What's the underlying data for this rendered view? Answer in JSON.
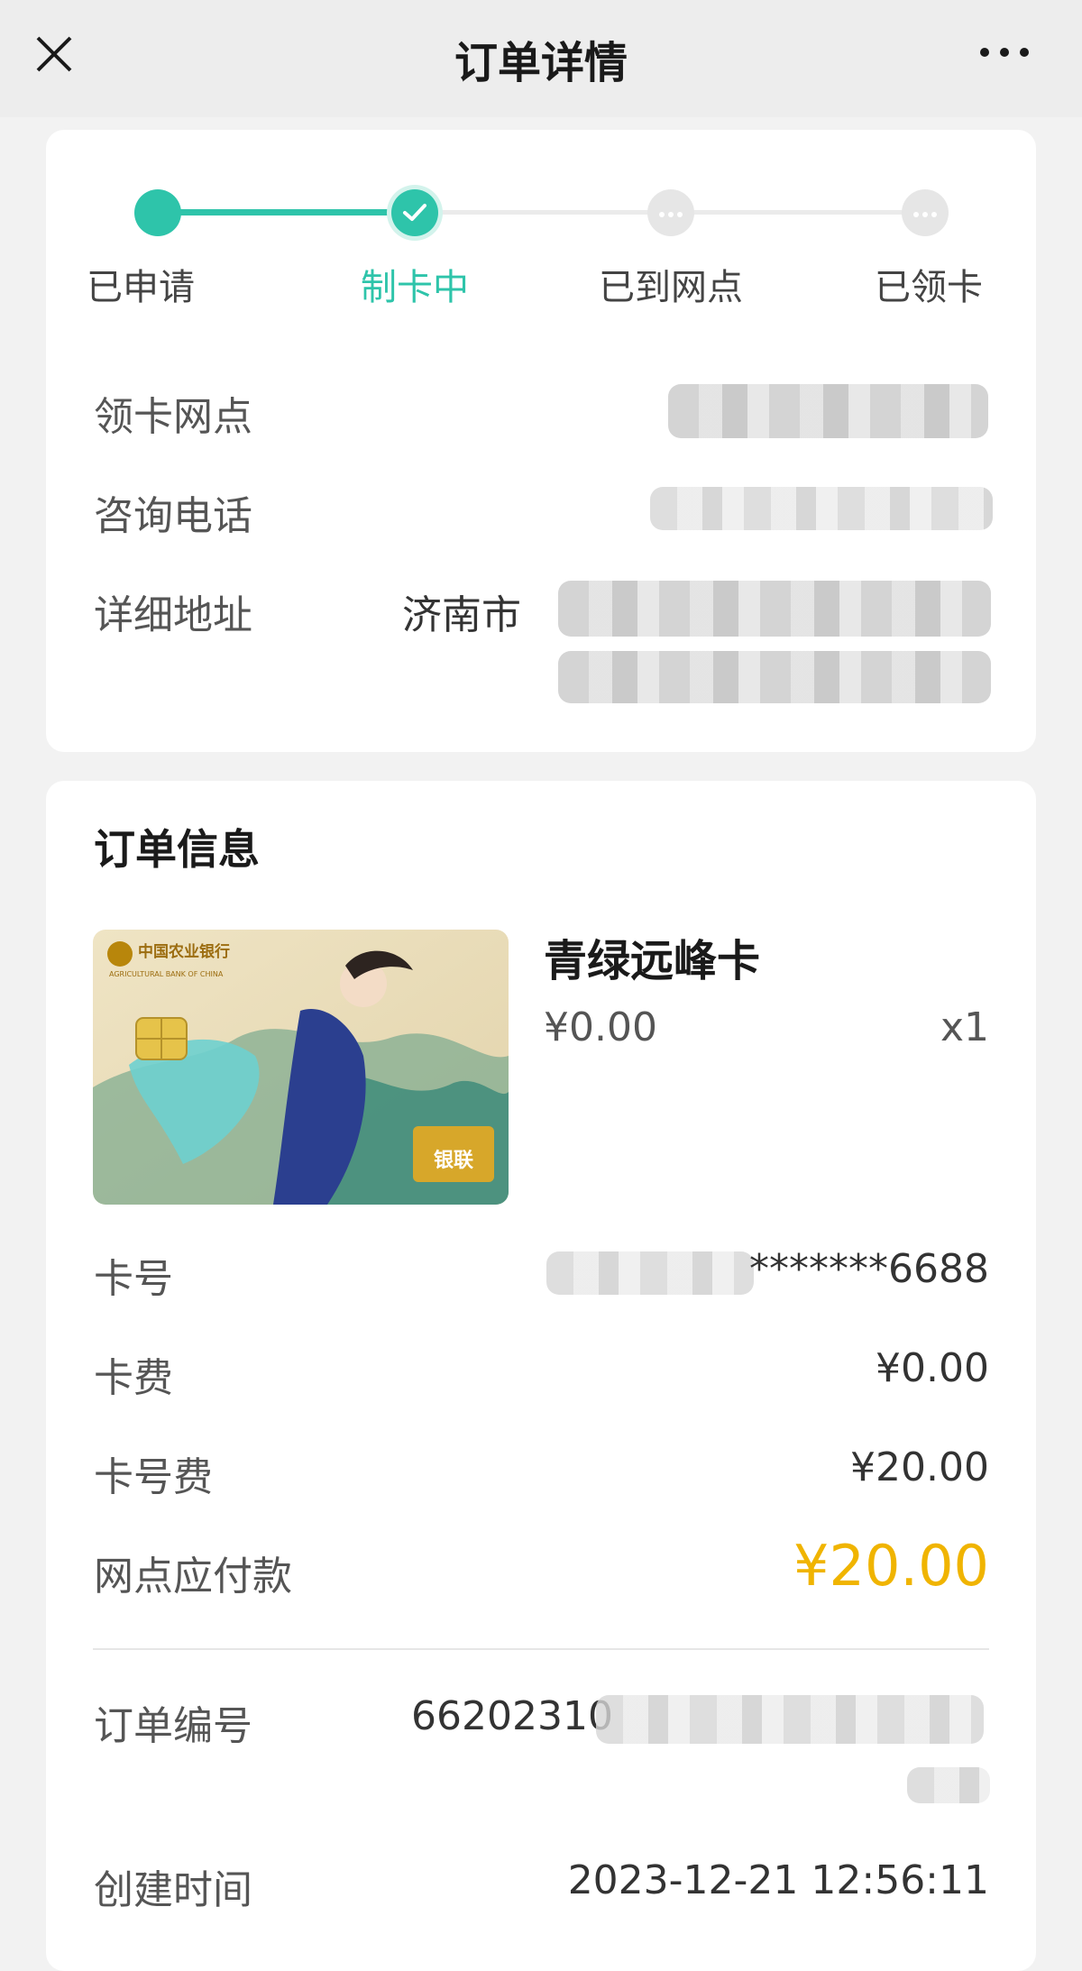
{
  "header": {
    "title": "订单详情"
  },
  "progress": {
    "steps": [
      {
        "label": "已申请",
        "state": "done"
      },
      {
        "label": "制卡中",
        "state": "current"
      },
      {
        "label": "已到网点",
        "state": "pending"
      },
      {
        "label": "已领卡",
        "state": "pending"
      }
    ]
  },
  "branch": {
    "outlet_label": "领卡网点",
    "phone_label": "咨询电话",
    "address_label": "详细地址",
    "address_prefix": "济南市"
  },
  "order": {
    "section_title": "订单信息",
    "card_image_bank_cn": "中国农业银行",
    "card_image_bank_en": "AGRICULTURAL BANK OF CHINA",
    "card_image_unionpay": "银联",
    "product_name": "青绿远峰卡",
    "product_price": "¥0.00",
    "product_qty": "x1",
    "rows": {
      "card_no_label": "卡号",
      "card_no_value": "*******6688",
      "card_fee_label": "卡费",
      "card_fee_value": "¥0.00",
      "number_fee_label": "卡号费",
      "number_fee_value": "¥20.00",
      "due_label": "网点应付款",
      "due_value": "¥20.00",
      "order_no_label": "订单编号",
      "order_no_prefix": "66202310",
      "created_label": "创建时间",
      "created_value": "2023-12-21 12:56:11"
    }
  },
  "colors": {
    "accent": "#2ec4aa",
    "highlight": "#f0b400",
    "pending": "#e6e6e6"
  }
}
